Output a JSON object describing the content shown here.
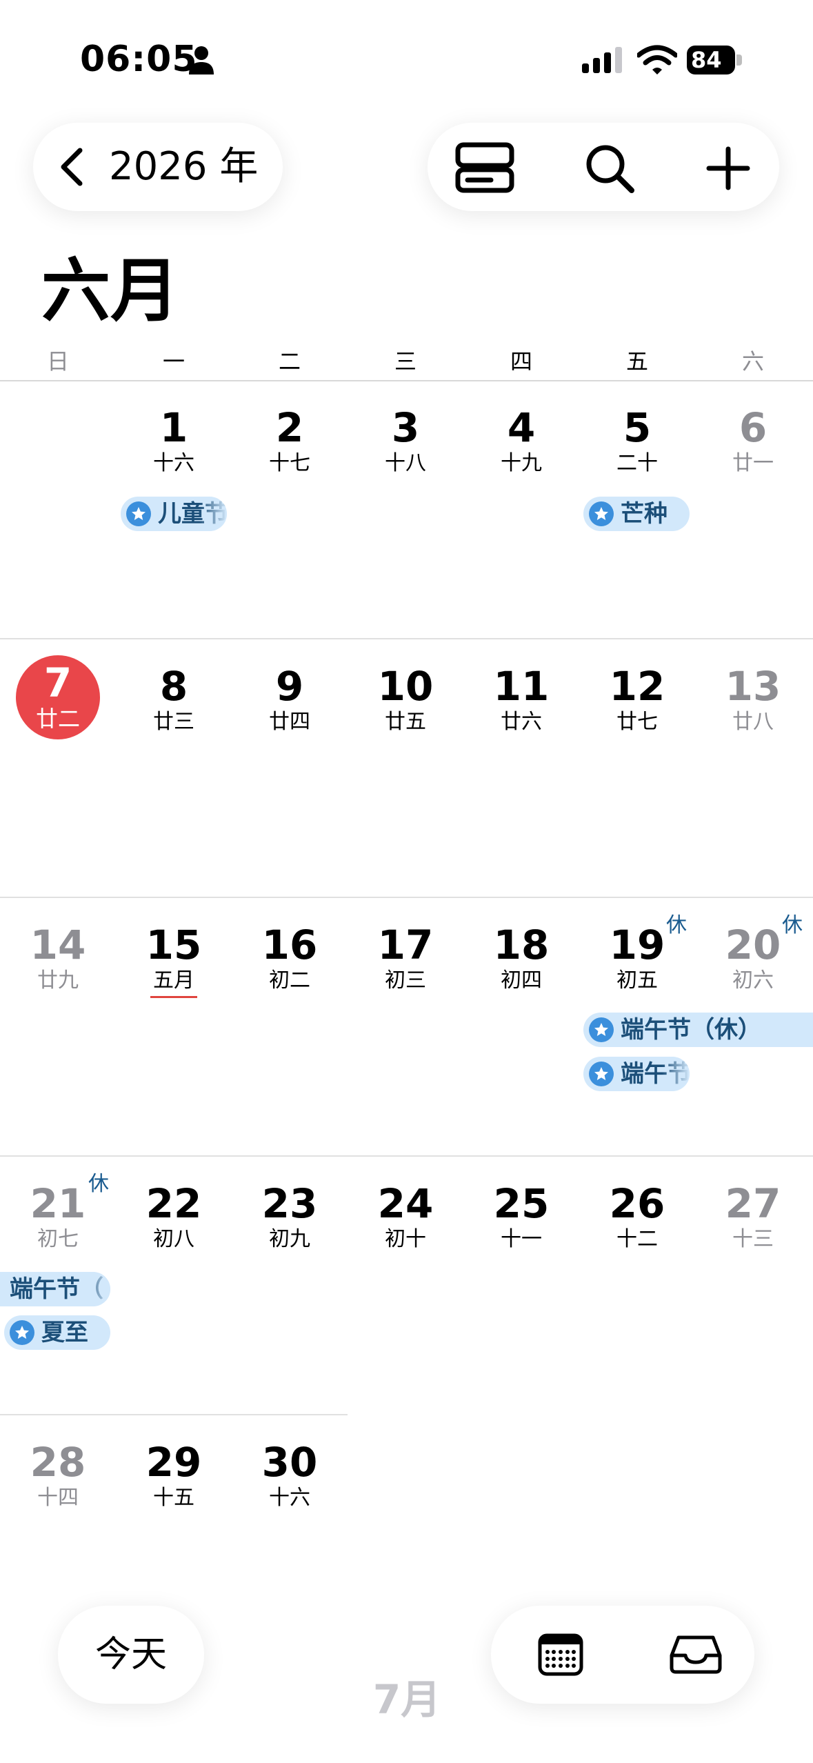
{
  "status": {
    "time": "06:05",
    "battery": "84"
  },
  "header": {
    "year": "2026 年"
  },
  "month_title": "六月",
  "weekdays": [
    "日",
    "一",
    "二",
    "三",
    "四",
    "五",
    "六"
  ],
  "days": [
    {
      "n": "1",
      "l": "十六"
    },
    {
      "n": "2",
      "l": "十七"
    },
    {
      "n": "3",
      "l": "十八"
    },
    {
      "n": "4",
      "l": "十九"
    },
    {
      "n": "5",
      "l": "二十"
    },
    {
      "n": "6",
      "l": "廿一"
    },
    {
      "n": "7",
      "l": "廿二"
    },
    {
      "n": "8",
      "l": "廿三"
    },
    {
      "n": "9",
      "l": "廿四"
    },
    {
      "n": "10",
      "l": "廿五"
    },
    {
      "n": "11",
      "l": "廿六"
    },
    {
      "n": "12",
      "l": "廿七"
    },
    {
      "n": "13",
      "l": "廿八"
    },
    {
      "n": "14",
      "l": "廿九"
    },
    {
      "n": "15",
      "l": "五月"
    },
    {
      "n": "16",
      "l": "初二"
    },
    {
      "n": "17",
      "l": "初三"
    },
    {
      "n": "18",
      "l": "初四"
    },
    {
      "n": "19",
      "l": "初五"
    },
    {
      "n": "20",
      "l": "初六"
    },
    {
      "n": "21",
      "l": "初七"
    },
    {
      "n": "22",
      "l": "初八"
    },
    {
      "n": "23",
      "l": "初九"
    },
    {
      "n": "24",
      "l": "初十"
    },
    {
      "n": "25",
      "l": "十一"
    },
    {
      "n": "26",
      "l": "十二"
    },
    {
      "n": "27",
      "l": "十三"
    },
    {
      "n": "28",
      "l": "十四"
    },
    {
      "n": "29",
      "l": "十五"
    },
    {
      "n": "30",
      "l": "十六"
    }
  ],
  "rest_mark": "休",
  "events": {
    "childrens_day": "儿童节",
    "grain_in_ear": "芒种",
    "dragon_boat_rest": "端午节（休）",
    "dragon_boat": "端午节",
    "dragon_boat_cont": "端午节（",
    "summer_solstice": "夏至"
  },
  "bottom": {
    "today": "今天",
    "next_month": "7月"
  },
  "colors": {
    "today": "#e9464a",
    "event_bg": "#d2e8fb",
    "event_text": "#1c4f79",
    "star": "#3b8fdc",
    "rest": "#1a5b8f"
  }
}
